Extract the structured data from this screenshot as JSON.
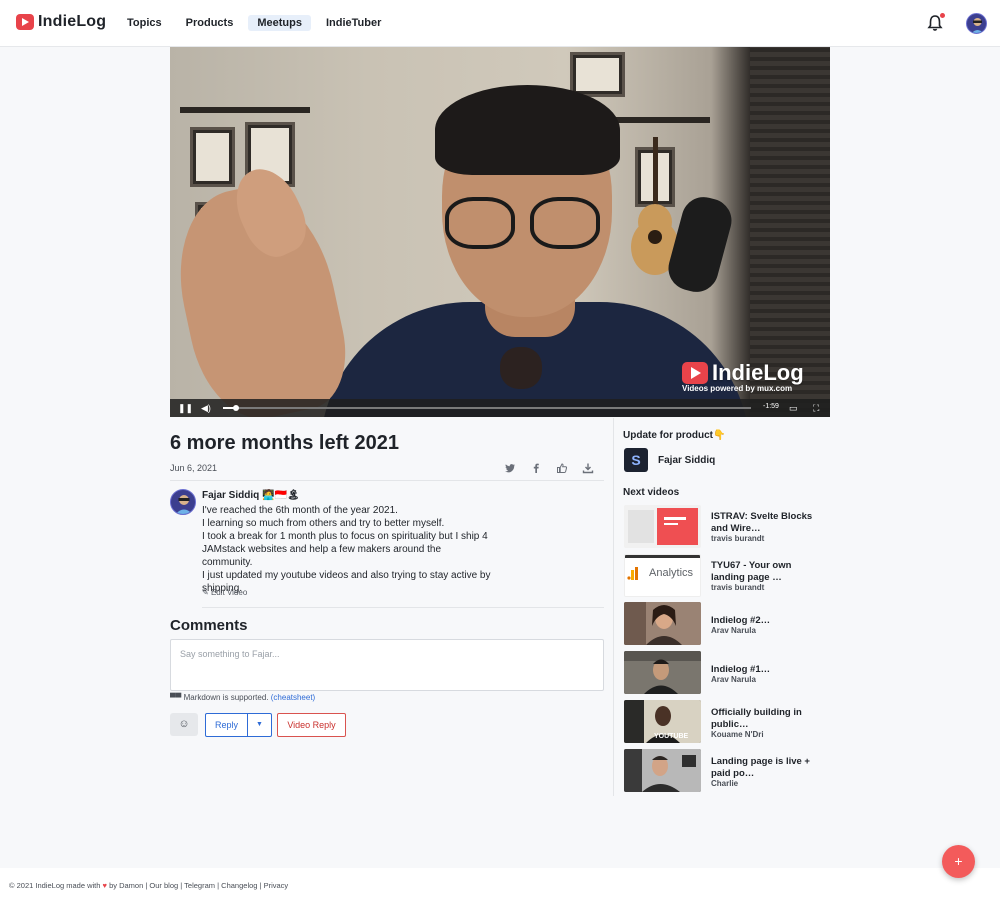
{
  "header": {
    "logo_text": "IndieLog",
    "nav": [
      "Topics",
      "Products",
      "Meetups",
      "IndieTuber"
    ],
    "active_nav": "Meetups"
  },
  "video": {
    "watermark": "IndieLog",
    "watermark_sub": "Videos powered by mux.com",
    "time_remaining": "-1:59",
    "progress": 0.025
  },
  "post": {
    "title": "6 more months left 2021",
    "date": "Jun 6, 2021",
    "author": "Fajar Siddiq",
    "author_badges": "🧑‍💻🇮🇩🏝",
    "description_lines": [
      "I've reached the 6th month of the year 2021.",
      "I learning so much from others and try to better myself.",
      "I took a break for 1 month plus to focus on spirituality but I ship 4 JAMstack websites and help a few makers around the community.",
      "I just updated my youtube videos and also trying to stay active by shipping."
    ],
    "edit_label": "Edit Video"
  },
  "comments": {
    "heading": "Comments",
    "placeholder": "Say something to Fajar...",
    "markdown_note": "Markdown is supported.",
    "cheatsheet": "(cheatsheet)",
    "reply_label": "Reply",
    "video_reply_label": "Video Reply"
  },
  "sidebar": {
    "update_heading": "Update for product👇",
    "product_name": "Fajar Siddiq",
    "product_logo": "S",
    "next_heading": "Next videos",
    "next_videos": [
      {
        "title": "ISTRAV: Svelte Blocks and Wire…",
        "author": "travis burandt"
      },
      {
        "title": "TYU67 - Your own landing page …",
        "author": "travis burandt"
      },
      {
        "title": "Indielog #2…",
        "author": "Arav Narula"
      },
      {
        "title": "Indielog #1…",
        "author": "Arav Narula"
      },
      {
        "title": "Officially building in public…",
        "author": "Kouame N'Dri"
      },
      {
        "title": "Landing page is live + paid po…",
        "author": "Charlie"
      }
    ],
    "thumb_texts": {
      "analytics": "Analytics",
      "youtube": "YOUTUBE"
    }
  },
  "footer": {
    "prefix": "© 2021 IndieLog made with",
    "by": "by Damon",
    "links": [
      "Our blog",
      "Telegram",
      "Changelog",
      "Privacy"
    ]
  },
  "colors": {
    "brand": "#e8434a",
    "link": "#2e6bd6",
    "fab": "#f35b5b"
  }
}
